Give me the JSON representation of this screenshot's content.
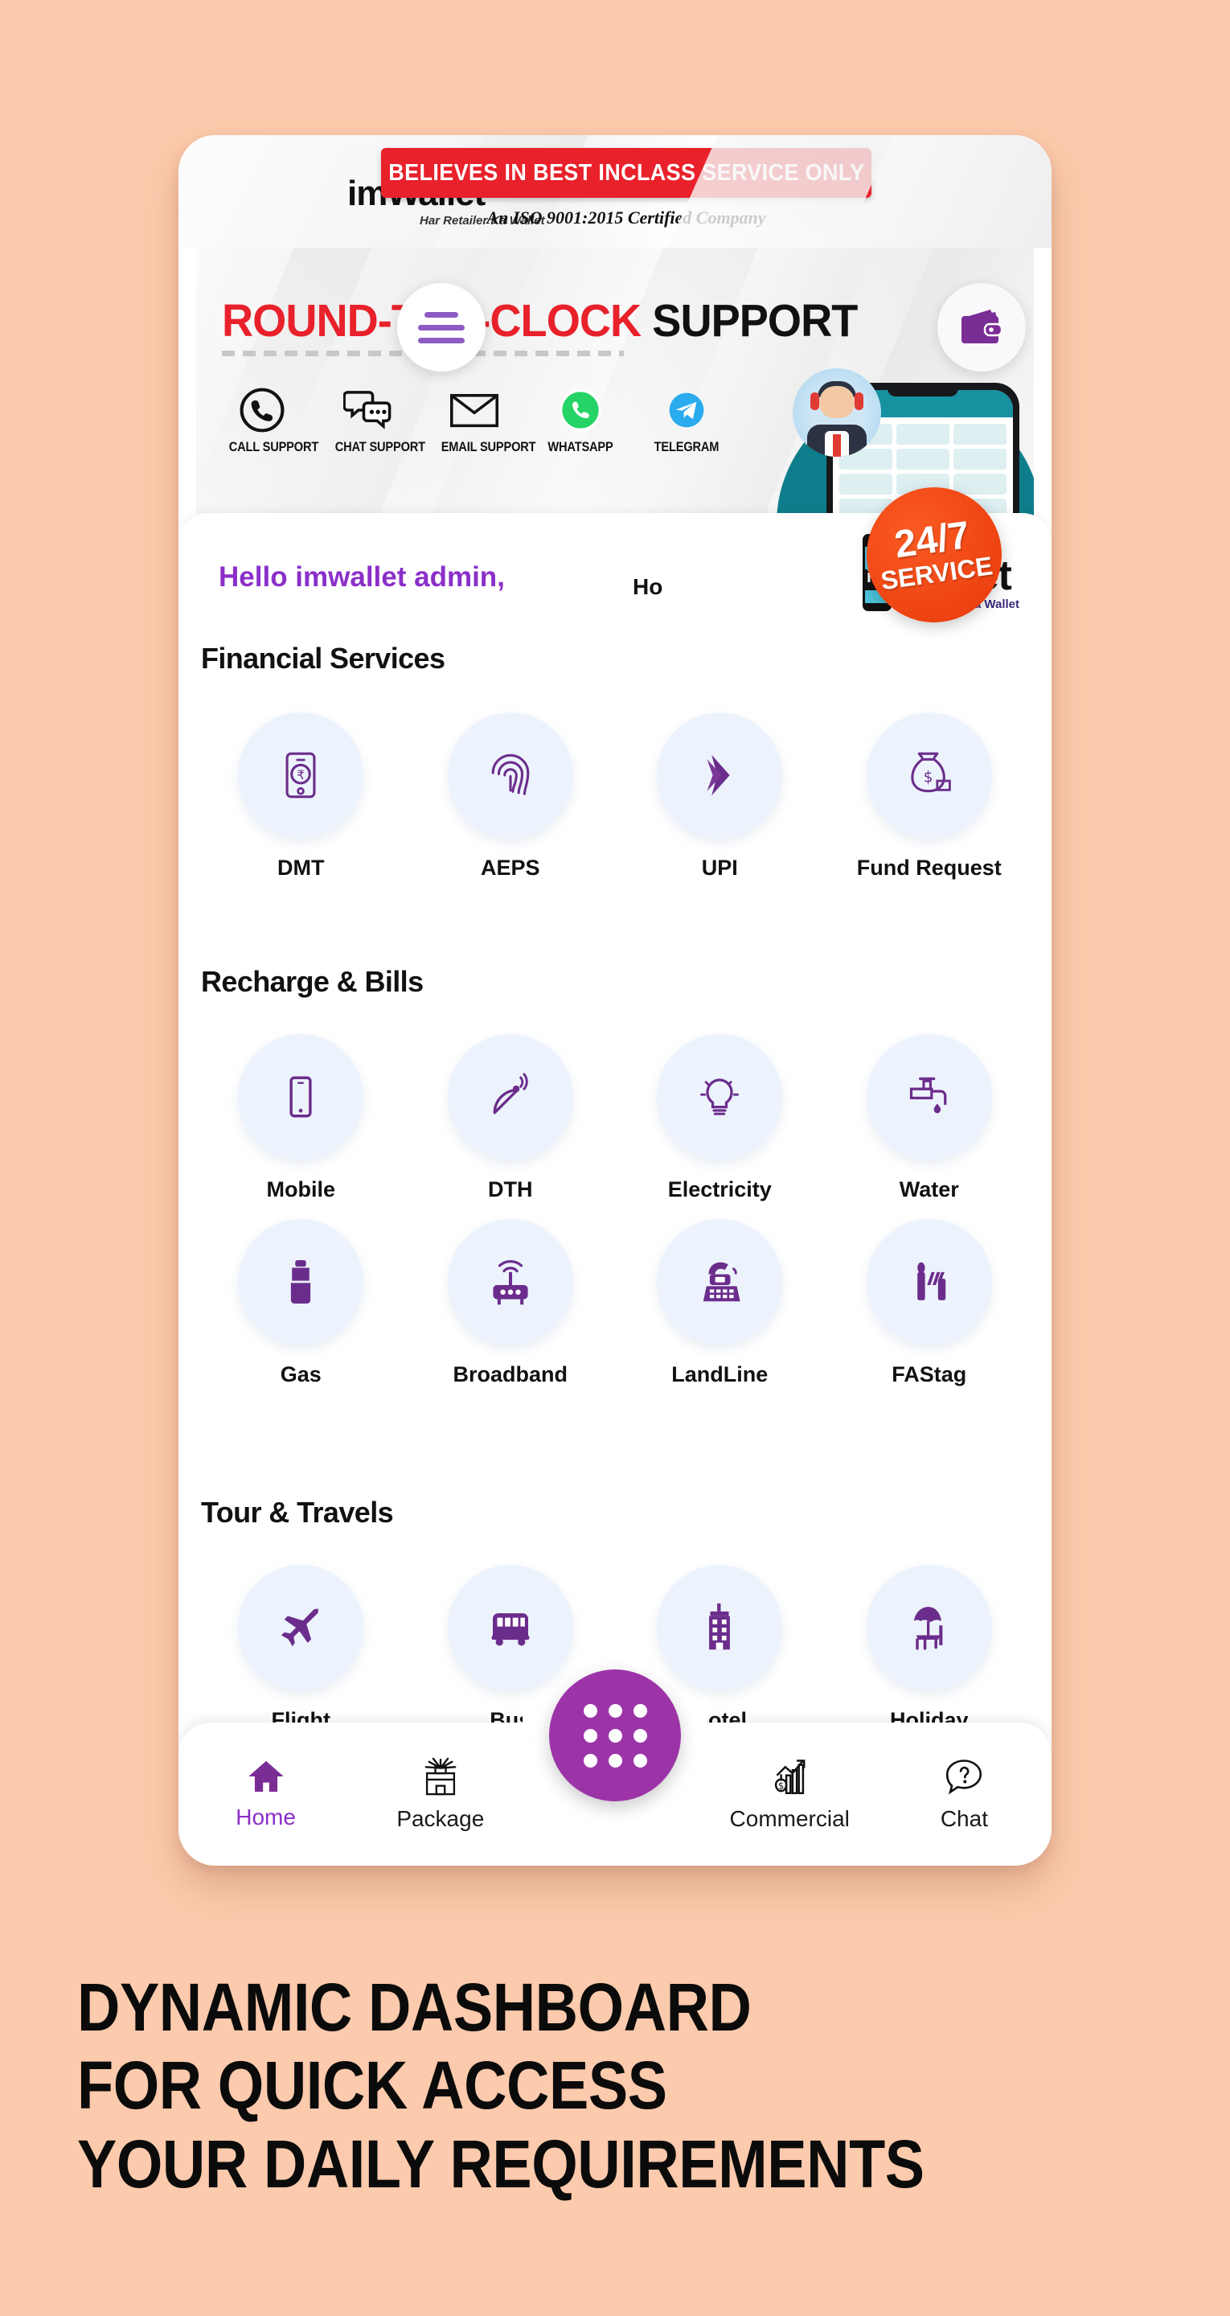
{
  "background_color": "#FCCAAC",
  "accent_purple": "#8B2FC9",
  "fab_purple": "#9C34A8",
  "banner_red": "#E8212B",
  "bubble_bg": "#EDF3FC",
  "header": {
    "brand_name": "imWallet",
    "brand_sub": "Har Retailer Ka Wallet",
    "marquee": "BELIEVES IN BEST INCLASS SERVICE ONLY",
    "iso_line": "An ISO 9001:2015 Certified Company",
    "menu_icon": "hamburger-menu-icon",
    "wallet_icon": "wallet-icon"
  },
  "promo": {
    "title_red": "ROUND-THE-CLOCK",
    "title_black": " SUPPORT",
    "badge_number": "24/7",
    "badge_word": "SERVICE",
    "supports": [
      {
        "label": "CALL SUPPORT",
        "icon": "phone-circle-icon"
      },
      {
        "label": "CHAT SUPPORT",
        "icon": "chat-bubbles-icon"
      },
      {
        "label": "EMAIL SUPPORT",
        "icon": "envelope-icon"
      },
      {
        "label": "WHATSAPP",
        "icon": "whatsapp-icon"
      },
      {
        "label": "TELEGRAM",
        "icon": "telegram-icon"
      }
    ],
    "mock_phone_title": "Home"
  },
  "greeting": "Hello  imwallet admin,",
  "logo": {
    "im": "im",
    "wallet": "Wallet",
    "tagline": "Har Retailer Ka Wallet"
  },
  "sections": [
    {
      "title": "Financial Services",
      "items": [
        {
          "label": "DMT",
          "icon": "mobile-rupee-icon"
        },
        {
          "label": "AEPS",
          "icon": "fingerprint-icon"
        },
        {
          "label": "UPI",
          "icon": "upi-arrow-icon"
        },
        {
          "label": "Fund Request",
          "icon": "money-bag-icon"
        }
      ]
    },
    {
      "title": "Recharge & Bills",
      "items": [
        {
          "label": "Mobile",
          "icon": "smartphone-icon"
        },
        {
          "label": "DTH",
          "icon": "satellite-dish-icon"
        },
        {
          "label": "Electricity",
          "icon": "light-bulb-icon"
        },
        {
          "label": "Water",
          "icon": "water-tap-icon"
        },
        {
          "label": "Gas",
          "icon": "gas-cylinder-icon"
        },
        {
          "label": "Broadband",
          "icon": "wifi-router-icon"
        },
        {
          "label": "LandLine",
          "icon": "landline-phone-icon"
        },
        {
          "label": "FAStag",
          "icon": "toll-barrier-icon"
        }
      ]
    },
    {
      "title": "Tour & Travels",
      "items": [
        {
          "label": "Flight",
          "icon": "airplane-icon"
        },
        {
          "label": "Bus",
          "icon": "bus-icon"
        },
        {
          "label": "Hotel",
          "icon": "building-icon"
        },
        {
          "label": "Holiday",
          "icon": "beach-umbrella-icon"
        }
      ]
    }
  ],
  "bottom_nav": {
    "items": [
      {
        "label": "Home",
        "icon": "home-icon",
        "active": true
      },
      {
        "label": "Package",
        "icon": "gift-package-icon",
        "active": false
      },
      {
        "label": "Commercial",
        "icon": "bar-chart-icon",
        "active": false
      },
      {
        "label": "Chat",
        "icon": "question-chat-icon",
        "active": false
      }
    ],
    "fab_icon": "apps-grid-icon",
    "obscured_label": "Ho"
  },
  "headline": {
    "line1": "DYNAMIC DASHBOARD",
    "line2": "FOR QUICK ACCESS",
    "line3": "YOUR DAILY REQUIREMENTS"
  }
}
